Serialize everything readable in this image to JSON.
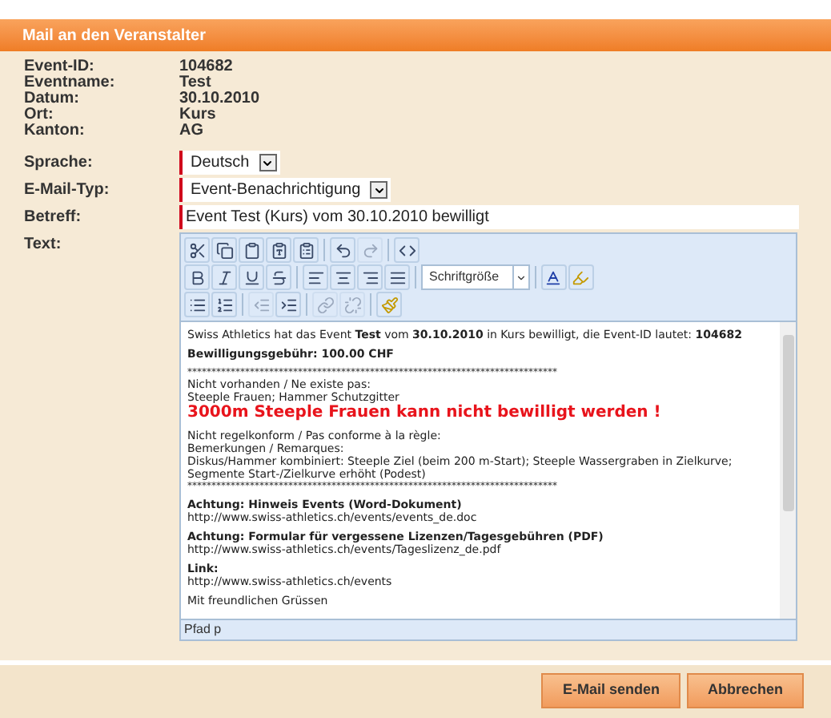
{
  "dialog": {
    "title": "Mail an den Veranstalter"
  },
  "info": [
    {
      "label": "Event-ID:",
      "value": "104682"
    },
    {
      "label": "Eventname:",
      "value": "Test"
    },
    {
      "label": "Datum:",
      "value": "30.10.2010"
    },
    {
      "label": "Ort:",
      "value": "Kurs"
    },
    {
      "label": "Kanton:",
      "value": "AG"
    }
  ],
  "form": [
    {
      "kind": "select",
      "label": "Sprache:",
      "value": "Deutsch",
      "required": true
    },
    {
      "kind": "select",
      "label": "E-Mail-Typ:",
      "value": "Event-Benachrichtigung",
      "required": true
    },
    {
      "kind": "input",
      "label": "Betreff:",
      "value": "Event Test (Kurs) vom 30.10.2010 bewilligt",
      "required": true
    }
  ],
  "editor": {
    "label": "Text:",
    "toolbar": [
      [
        {
          "kind": "cut",
          "disabled": false
        },
        {
          "kind": "copy",
          "disabled": false
        },
        {
          "kind": "paste",
          "disabled": false
        },
        {
          "kind": "paste_text",
          "disabled": false
        },
        {
          "kind": "paste_word",
          "disabled": false
        },
        {
          "kind": "sep"
        },
        {
          "kind": "undo",
          "disabled": false
        },
        {
          "kind": "redo",
          "disabled": true
        },
        {
          "kind": "sep"
        },
        {
          "kind": "html",
          "disabled": false
        }
      ],
      [
        {
          "kind": "bold",
          "disabled": false
        },
        {
          "kind": "italic",
          "disabled": false
        },
        {
          "kind": "underline",
          "disabled": false
        },
        {
          "kind": "strike",
          "disabled": false
        },
        {
          "kind": "sep"
        },
        {
          "kind": "align_left",
          "disabled": false
        },
        {
          "kind": "align_center",
          "disabled": false
        },
        {
          "kind": "align_right",
          "disabled": false
        },
        {
          "kind": "justify",
          "disabled": false
        },
        {
          "kind": "sep"
        },
        {
          "kind": "fontsize",
          "label": "Schriftgröße"
        },
        {
          "kind": "sep"
        },
        {
          "kind": "forecolor",
          "disabled": false
        },
        {
          "kind": "highlight",
          "disabled": false
        }
      ],
      [
        {
          "kind": "bullets",
          "disabled": false
        },
        {
          "kind": "numbers",
          "disabled": false
        },
        {
          "kind": "sep"
        },
        {
          "kind": "outdent",
          "disabled": true
        },
        {
          "kind": "indent",
          "disabled": false
        },
        {
          "kind": "sep"
        },
        {
          "kind": "link",
          "disabled": true
        },
        {
          "kind": "unlink",
          "disabled": true
        },
        {
          "kind": "sep"
        },
        {
          "kind": "clean",
          "disabled": false
        }
      ]
    ],
    "paragraphs": [
      [
        {
          "kind": "text",
          "text": "Swiss Athletics hat das Event **Test** vom **30.10.2010** in Kurs bewilligt, die Event-ID lautet: **104682**"
        }
      ],
      [
        {
          "kind": "bold",
          "text": "Bewilligungsgebühr: 100.00 CHF"
        }
      ],
      [
        {
          "kind": "rule",
          "text": "*****************************************************************************"
        },
        {
          "kind": "text",
          "text": "Nicht vorhanden / Ne existe pas:"
        },
        {
          "kind": "text",
          "text": "Steeple Frauen; Hammer Schutzgitter"
        },
        {
          "kind": "warning",
          "text": "3000m Steeple Frauen kann nicht bewilligt werden !"
        }
      ],
      [
        {
          "kind": "text",
          "text": "Nicht regelkonform / Pas conforme à la règle:"
        },
        {
          "kind": "text",
          "text": "Bemerkungen / Remarques:"
        },
        {
          "kind": "text",
          "text": "Diskus/Hammer kombiniert: Steeple Ziel (beim 200 m-Start); Steeple Wassergraben in Zielkurve; Segmente Start-/Zielkurve erhöht (Podest)"
        },
        {
          "kind": "rule",
          "text": "*****************************************************************************"
        }
      ],
      [
        {
          "kind": "bold",
          "text": "Achtung: Hinweis Events (Word-Dokument)"
        },
        {
          "kind": "text",
          "text": "http://www.swiss-athletics.ch/events/events_de.doc"
        }
      ],
      [
        {
          "kind": "bold",
          "text": "Achtung: Formular für vergessene Lizenzen/Tagesgebühren (PDF)"
        },
        {
          "kind": "text",
          "text": "http://www.swiss-athletics.ch/events/Tageslizenz_de.pdf"
        }
      ],
      [
        {
          "kind": "bold",
          "text": "Link:"
        },
        {
          "kind": "text",
          "text": "http://www.swiss-athletics.ch/events"
        }
      ],
      [
        {
          "kind": "text",
          "text": "Mit freundlichen Grüssen"
        }
      ]
    ],
    "path": "Pfad p"
  },
  "buttons": [
    "E-Mail senden",
    "Abbrechen"
  ]
}
